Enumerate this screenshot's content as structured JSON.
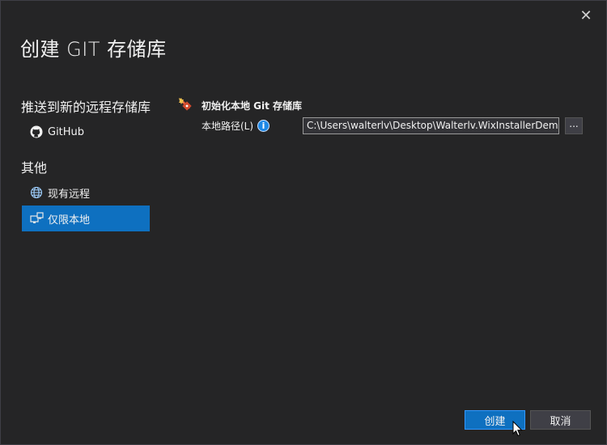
{
  "dialog": {
    "title": "创建 GIT 存储库",
    "close_label": "✕"
  },
  "sidebar": {
    "push_section_title": "推送到新的远程存储库",
    "push_items": [
      {
        "label": "GitHub",
        "icon": "github-icon"
      }
    ],
    "other_section_title": "其他",
    "other_items": [
      {
        "label": "现有远程",
        "icon": "globe-icon"
      },
      {
        "label": "仅限本地",
        "icon": "local-computer-icon",
        "selected": true
      }
    ]
  },
  "main": {
    "header_label": "初始化本地 Git 存储库",
    "header_icon": "git-init-icon",
    "path_label": "本地路径(L)",
    "path_value": "C:\\Users\\walterlv\\Desktop\\Walterlv.WixInstallerDemo",
    "browse_label": "..."
  },
  "footer": {
    "create_label": "创建",
    "cancel_label": "取消"
  },
  "colors": {
    "background": "#252526",
    "accent": "#0e70c0",
    "text": "#f1f1f1"
  }
}
